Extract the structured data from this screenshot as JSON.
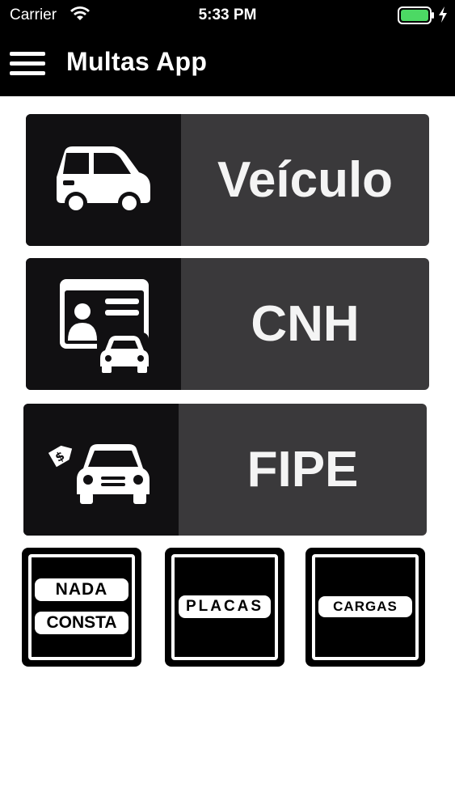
{
  "status_bar": {
    "carrier": "Carrier",
    "time": "5:33 PM",
    "battery_color": "#4cd964"
  },
  "nav": {
    "title": "Multas App",
    "menu_icon": "hamburger-menu-icon"
  },
  "cards": [
    {
      "label": "Veículo",
      "icon": "car-icon"
    },
    {
      "label": "CNH",
      "icon": "driver-license-icon"
    },
    {
      "label": "FIPE",
      "icon": "car-price-tag-icon"
    }
  ],
  "signs": {
    "nada_consta": {
      "line1": "NADA",
      "line2": "CONSTA"
    },
    "placas": {
      "label": "PLACAS"
    },
    "cargas": {
      "label": "CARGAS"
    }
  },
  "colors": {
    "card_bg": "#3a393b",
    "icon_bg": "#111012",
    "bar_bg": "#000000"
  }
}
